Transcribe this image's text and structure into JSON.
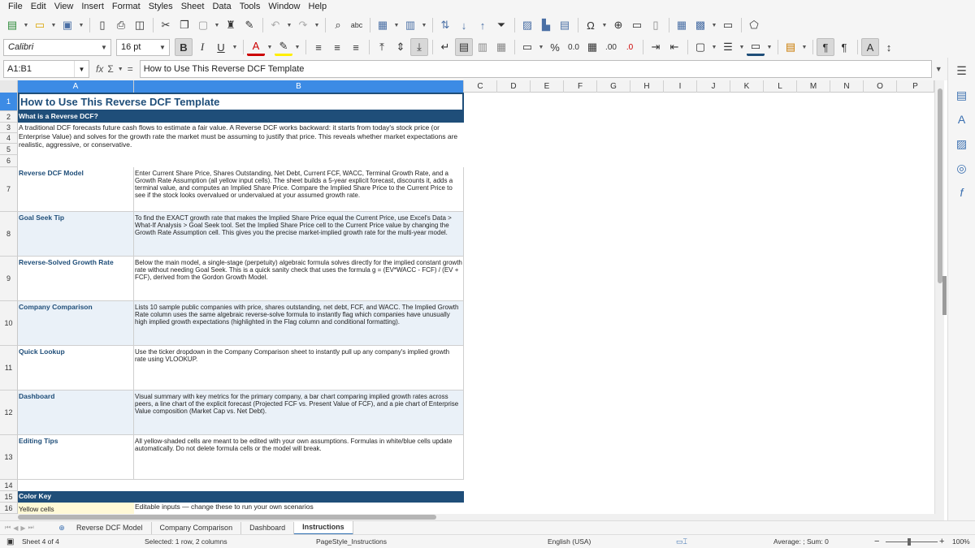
{
  "menu": [
    "File",
    "Edit",
    "View",
    "Insert",
    "Format",
    "Styles",
    "Sheet",
    "Data",
    "Tools",
    "Window",
    "Help"
  ],
  "toolbar": {
    "font_name": "Calibri",
    "font_size": "16 pt",
    "bold_label": "B",
    "italic_label": "I",
    "underline_label": "U",
    "percent_label": "%",
    "decimal_label": "0.0",
    "add_decimal_label": ".00",
    "del_decimal_label": ".0"
  },
  "formula_bar": {
    "cell_ref": "A1:B1",
    "fx_label": "fx",
    "sum_label": "Σ",
    "eq_label": "=",
    "content": "How to Use This Reverse DCF Template"
  },
  "columns": [
    "A",
    "B",
    "C",
    "D",
    "E",
    "F",
    "G",
    "H",
    "I",
    "J",
    "K",
    "L",
    "M",
    "N",
    "O",
    "P"
  ],
  "rows": [
    "1",
    "2",
    "3",
    "4",
    "5",
    "6",
    "7",
    "8",
    "9",
    "10",
    "11",
    "12",
    "13",
    "14",
    "15",
    "16"
  ],
  "sheet": {
    "title": "How to Use This Reverse DCF Template",
    "what_header": "What is a Reverse DCF?",
    "intro": "A traditional DCF forecasts future cash flows to estimate a fair value. A Reverse DCF works backward: it starts from today's stock price (or Enterprise Value) and solves for the growth rate the market must be assuming to justify that price. This reveals whether market expectations are realistic, aggressive, or conservative.",
    "items": [
      {
        "label": "Reverse DCF Model",
        "text": "Enter Current Share Price, Shares Outstanding, Net Debt, Current FCF, WACC, Terminal Growth Rate, and a Growth Rate Assumption (all yellow input cells). The sheet builds a 5-year explicit forecast, discounts it, adds a terminal value, and computes an Implied Share Price. Compare the Implied Share Price to the Current Price to see if the stock looks overvalued or undervalued at your assumed growth rate."
      },
      {
        "label": "Goal Seek Tip",
        "text": "To find the EXACT growth rate that makes the Implied Share Price equal the Current Price, use Excel's Data > What-If Analysis > Goal Seek tool. Set the Implied Share Price cell to the Current Price value by changing the Growth Rate Assumption cell. This gives you the precise market-implied growth rate for the multi-year model."
      },
      {
        "label": "Reverse-Solved Growth Rate",
        "text": "Below the main model, a single-stage (perpetuity) algebraic formula solves directly for the implied constant growth rate without needing Goal Seek. This is a quick sanity check that uses the formula g = (EV*WACC - FCF) / (EV + FCF), derived from the Gordon Growth Model."
      },
      {
        "label": "Company Comparison",
        "text": "Lists 10 sample public companies with price, shares outstanding, net debt, FCF, and WACC. The Implied Growth Rate column uses the same algebraic reverse-solve formula to instantly flag which companies have unusually high implied growth expectations (highlighted in the Flag column and conditional formatting)."
      },
      {
        "label": "Quick Lookup",
        "text": "Use the ticker dropdown in the Company Comparison sheet to instantly pull up any company's implied growth rate using VLOOKUP."
      },
      {
        "label": "Dashboard",
        "text": "Visual summary with key metrics for the primary company, a bar chart comparing implied growth rates across peers, a line chart of the explicit forecast (Projected FCF vs. Present Value of FCF), and a pie chart of Enterprise Value composition (Market Cap vs. Net Debt)."
      },
      {
        "label": "Editing Tips",
        "text": "All yellow-shaded cells are meant to be edited with your own assumptions. Formulas in white/blue cells update automatically. Do not delete formula cells or the model will break."
      }
    ],
    "color_key_header": "Color Key",
    "yellow_label": "Yellow cells",
    "yellow_text": "Editable inputs — change these to run your own scenarios"
  },
  "tabs": [
    "Reverse DCF Model",
    "Company Comparison",
    "Dashboard",
    "Instructions"
  ],
  "active_tab": "Instructions",
  "status": {
    "sheet": "Sheet 4 of 4",
    "selected": "Selected: 1 row, 2 columns",
    "page_style": "PageStyle_Instructions",
    "language": "English (USA)",
    "summary": "Average: ; Sum: 0",
    "zoom": "100%"
  },
  "colors": {
    "header_band": "#1f4e79",
    "selection": "#3c8be5",
    "alt_row": "#eaf1f8"
  }
}
